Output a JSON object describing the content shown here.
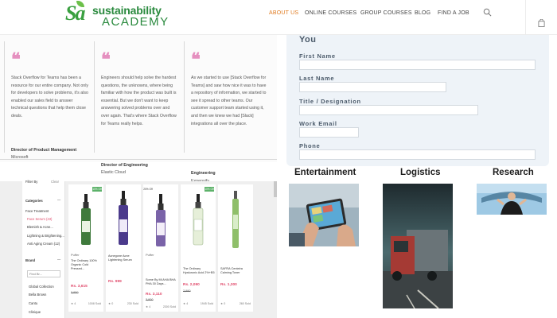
{
  "brand": {
    "mark": "Sa",
    "line1": "sustainability",
    "line2": "ACADEMY",
    "color": "#2a8a3e"
  },
  "nav": {
    "links": [
      {
        "label": "ABOUT US",
        "active": true
      },
      {
        "label": "ONLINE COURSES",
        "active": false
      },
      {
        "label": "GROUP COURSES",
        "active": false
      },
      {
        "label": "BLOG",
        "active": false
      },
      {
        "label": "FIND A JOB",
        "active": false
      }
    ],
    "accent": "#e07a1f",
    "icons": [
      "search-icon",
      "shopping-bag-icon"
    ]
  },
  "testimonials": [
    {
      "quote": "Stack Overflow for Teams has been a resource for our entire company. Not only for developers to solve problems, it's also enabled our sales field to answer technical questions that help them close deals.",
      "name": "Director of Product Management",
      "org": "Microsoft"
    },
    {
      "quote": "Engineers should help solve the hardest questions, the unknowns, where being familiar with how the product was built is essential. But we don't want to keep answering solved problems over and over again. That's where Stack Overflow for Teams really helps.",
      "name": "Director of Engineering",
      "org": "Elastic Cloud"
    },
    {
      "quote": "As we started to use [Stack Overflow for Teams] and saw how nice it was to have a repository of information, we started to see it spread to other teams. Our customer support team started using it, and then we knew we had [Slack] integrations all over the place.",
      "name": "Engineering",
      "org": "Expensify"
    }
  ],
  "form": {
    "title": "You",
    "fields": [
      {
        "label": "First Name",
        "value": ""
      },
      {
        "label": "Last Name",
        "value": ""
      },
      {
        "label": "Title / Designation",
        "value": ""
      },
      {
        "label": "Work Email",
        "value": ""
      },
      {
        "label": "Phone",
        "value": ""
      }
    ]
  },
  "shop": {
    "filter_header": "Filter By",
    "filter_clear": "Clear",
    "categories_title": "Categories",
    "categories": [
      "Face Treatment",
      "Face Serum (43)",
      "Blemish & Acne...",
      "Lightning & Brightening...",
      "Anti Aging Cream (12)"
    ],
    "brand_title": "Brand",
    "brand_search_placeholder": "Find Br...",
    "brands": [
      "Global Collection",
      "Bella Brown",
      "Cantu",
      "Clinique"
    ],
    "products": [
      {
        "brand": "Puffer",
        "name": "The Ordinary 100% Organic Cold Pressed...",
        "price": "Rs. 3,615",
        "old": "3,950",
        "rating": "4",
        "sold": "1008 Sold",
        "badge": "10% Off",
        "liquid": "#3f7a3c"
      },
      {
        "brand": "",
        "name": "Acnegone Acne Lightening Serum",
        "price": "Rs. 999",
        "old": "",
        "rating": "0",
        "sold": "230 Sold",
        "badge": "",
        "liquid": "#4b3a8c"
      },
      {
        "brand": "Puffer",
        "name": "Some By Mi AHA BHA PHA 30 Days...",
        "price": "Rs. 3,110",
        "old": "3,900",
        "rating": "4",
        "sold": "2300 Sold",
        "badge": "20% Off",
        "liquid": "#7a63a8"
      },
      {
        "brand": "",
        "name": "The Ordinary Hyaluronic Acid 2%+B5",
        "price": "Rs. 2,090",
        "old": "2,990",
        "rating": "4",
        "sold": "1945 Sold",
        "badge": "10% Off",
        "liquid": "#d8e8c8"
      },
      {
        "brand": "",
        "name": "SAFRA Centelra Calming Toner",
        "price": "Rs. 1,300",
        "old": "",
        "rating": "0",
        "sold": "260 Sold",
        "badge": "",
        "liquid": "#8fbf6a"
      }
    ]
  },
  "industries": [
    {
      "title": "Entertainment"
    },
    {
      "title": "Logistics"
    },
    {
      "title": "Research"
    }
  ]
}
